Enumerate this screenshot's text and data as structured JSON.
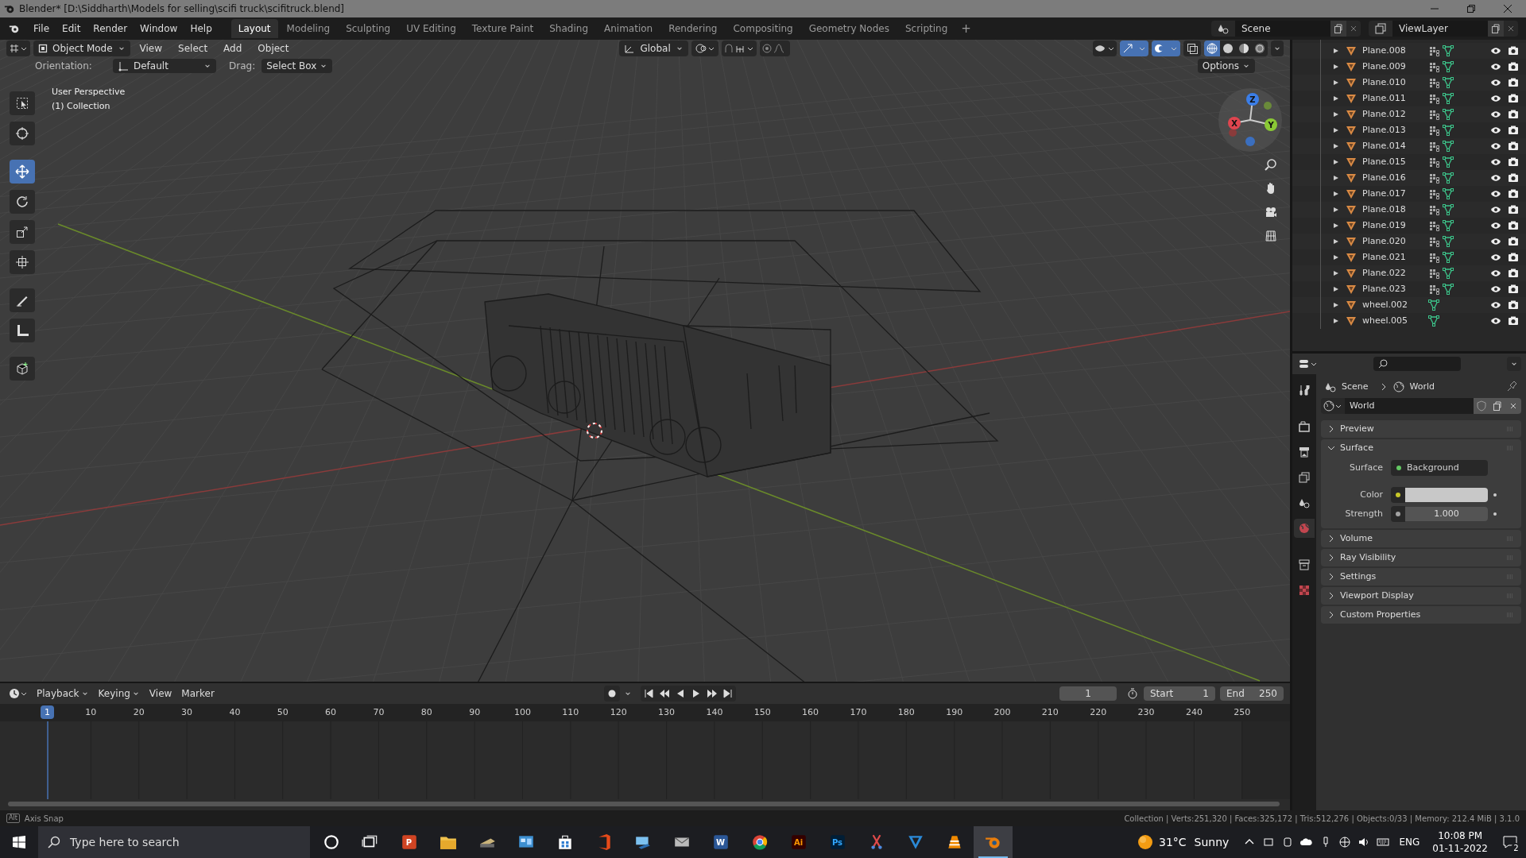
{
  "window": {
    "title": "Blender* [D:\\Siddharth\\Models for selling\\scifi truck\\scifitruck.blend]"
  },
  "menu": [
    "File",
    "Edit",
    "Render",
    "Window",
    "Help"
  ],
  "workspaces": [
    {
      "label": "Layout",
      "selected": true
    },
    {
      "label": "Modeling",
      "selected": false
    },
    {
      "label": "Sculpting",
      "selected": false
    },
    {
      "label": "UV Editing",
      "selected": false
    },
    {
      "label": "Texture Paint",
      "selected": false
    },
    {
      "label": "Shading",
      "selected": false
    },
    {
      "label": "Animation",
      "selected": false
    },
    {
      "label": "Rendering",
      "selected": false
    },
    {
      "label": "Compositing",
      "selected": false
    },
    {
      "label": "Geometry Nodes",
      "selected": false
    },
    {
      "label": "Scripting",
      "selected": false
    }
  ],
  "add_workspace": "+",
  "scene": "Scene",
  "view_layer": "ViewLayer",
  "viewport": {
    "mode": "Object Mode",
    "menus": [
      "View",
      "Select",
      "Add",
      "Object"
    ],
    "orientation_menu": "Global",
    "tool_settings": {
      "orientation_label": "Orientation:",
      "orientation": "Default",
      "drag_label": "Drag:",
      "drag": "Select Box",
      "options": "Options"
    },
    "overlay": [
      "User Perspective",
      "(1) Collection"
    ],
    "gizmo": [
      "X",
      "Y",
      "Z"
    ],
    "tools": [
      {
        "kind": "select",
        "selected": false
      },
      {
        "kind": "cursor",
        "selected": false
      },
      {
        "kind": "move",
        "selected": true
      },
      {
        "kind": "rotate",
        "selected": false
      },
      {
        "kind": "scale",
        "selected": false
      },
      {
        "kind": "transform",
        "selected": false
      },
      {
        "kind": "annotate",
        "selected": false
      },
      {
        "kind": "measure",
        "selected": false
      },
      {
        "kind": "add_cube",
        "selected": false
      }
    ],
    "shading": [
      {
        "kind": "wireframe",
        "selected": true
      },
      {
        "kind": "solid",
        "selected": false
      },
      {
        "kind": "material",
        "selected": false
      },
      {
        "kind": "rendered",
        "selected": false
      }
    ]
  },
  "outliner": {
    "items": [
      {
        "name": "Plane.008",
        "modifiers": true
      },
      {
        "name": "Plane.009",
        "modifiers": true
      },
      {
        "name": "Plane.010",
        "modifiers": true
      },
      {
        "name": "Plane.011",
        "modifiers": true
      },
      {
        "name": "Plane.012",
        "modifiers": true
      },
      {
        "name": "Plane.013",
        "modifiers": true
      },
      {
        "name": "Plane.014",
        "modifiers": true
      },
      {
        "name": "Plane.015",
        "modifiers": true
      },
      {
        "name": "Plane.016",
        "modifiers": true
      },
      {
        "name": "Plane.017",
        "modifiers": true
      },
      {
        "name": "Plane.018",
        "modifiers": true
      },
      {
        "name": "Plane.019",
        "modifiers": true
      },
      {
        "name": "Plane.020",
        "modifiers": true
      },
      {
        "name": "Plane.021",
        "modifiers": true
      },
      {
        "name": "Plane.022",
        "modifiers": true
      },
      {
        "name": "Plane.023",
        "modifiers": true
      },
      {
        "name": "wheel.002",
        "modifiers": false
      },
      {
        "name": "wheel.005",
        "modifiers": false
      }
    ]
  },
  "properties": {
    "tabs": [
      {
        "kind": "tool",
        "selected": false
      },
      {
        "kind": "render",
        "selected": false
      },
      {
        "kind": "output",
        "selected": false
      },
      {
        "kind": "view_layer",
        "selected": false
      },
      {
        "kind": "scene",
        "selected": false
      },
      {
        "kind": "world",
        "selected": true
      },
      {
        "kind": "collection",
        "selected": false
      },
      {
        "kind": "texture",
        "selected": false
      }
    ],
    "breadcrumb": [
      "Scene",
      "World"
    ],
    "world": "World",
    "panels": [
      {
        "title": "Preview",
        "expanded": false
      },
      {
        "title": "Surface",
        "expanded": true,
        "fields": [
          {
            "kind": "link",
            "label": "Surface",
            "value": "Background"
          },
          {
            "kind": "color",
            "label": "Color",
            "color": "#c8c8c8"
          },
          {
            "kind": "number",
            "label": "Strength",
            "value": "1.000"
          }
        ]
      },
      {
        "title": "Volume",
        "expanded": false
      },
      {
        "title": "Ray Visibility",
        "expanded": false
      },
      {
        "title": "Settings",
        "expanded": false
      },
      {
        "title": "Viewport Display",
        "expanded": false
      },
      {
        "title": "Custom Properties",
        "expanded": false
      }
    ]
  },
  "timeline": {
    "menus": [
      "Playback",
      "Keying",
      "View",
      "Marker"
    ],
    "current_frame": "1",
    "start_label": "Start",
    "start": "1",
    "end_label": "End",
    "end": "250",
    "playhead": "1",
    "ticks": [
      "10",
      "20",
      "30",
      "40",
      "50",
      "60",
      "70",
      "80",
      "90",
      "100",
      "110",
      "120",
      "130",
      "140",
      "150",
      "160",
      "170",
      "180",
      "190",
      "200",
      "210",
      "220",
      "230",
      "240",
      "250"
    ]
  },
  "status_bar": {
    "key": "Alt",
    "hint": "Axis Snap",
    "stats": "Collection | Verts:251,320 | Faces:325,172 | Tris:512,276 | Objects:0/33 | Memory: 212.4 MiB | 3.1.0"
  },
  "taskbar": {
    "search_placeholder": "Type here to search",
    "apps": [
      {
        "kind": "cortana",
        "selected": false
      },
      {
        "kind": "task_view",
        "selected": false
      },
      {
        "kind": "powerpoint",
        "label": "P",
        "selected": false
      },
      {
        "kind": "explorer",
        "selected": false
      },
      {
        "kind": "scanner",
        "selected": false
      },
      {
        "kind": "control_panel",
        "selected": false
      },
      {
        "kind": "store",
        "selected": false
      },
      {
        "kind": "office",
        "selected": false
      },
      {
        "kind": "remote",
        "selected": false
      },
      {
        "kind": "mail",
        "selected": false
      },
      {
        "kind": "word",
        "label": "W",
        "selected": false
      },
      {
        "kind": "chrome",
        "selected": false
      },
      {
        "kind": "illustrator",
        "label": "Ai",
        "selected": false
      },
      {
        "kind": "photoshop",
        "label": "Ps",
        "selected": false
      },
      {
        "kind": "snip",
        "selected": false
      },
      {
        "kind": "vector",
        "selected": false
      },
      {
        "kind": "vlc",
        "selected": false
      },
      {
        "kind": "blender",
        "selected": true
      }
    ],
    "weather": {
      "temperature": "31°C",
      "condition": "Sunny"
    },
    "language": "ENG",
    "time": "10:08 PM",
    "date": "01-11-2022",
    "notifications": "2"
  }
}
